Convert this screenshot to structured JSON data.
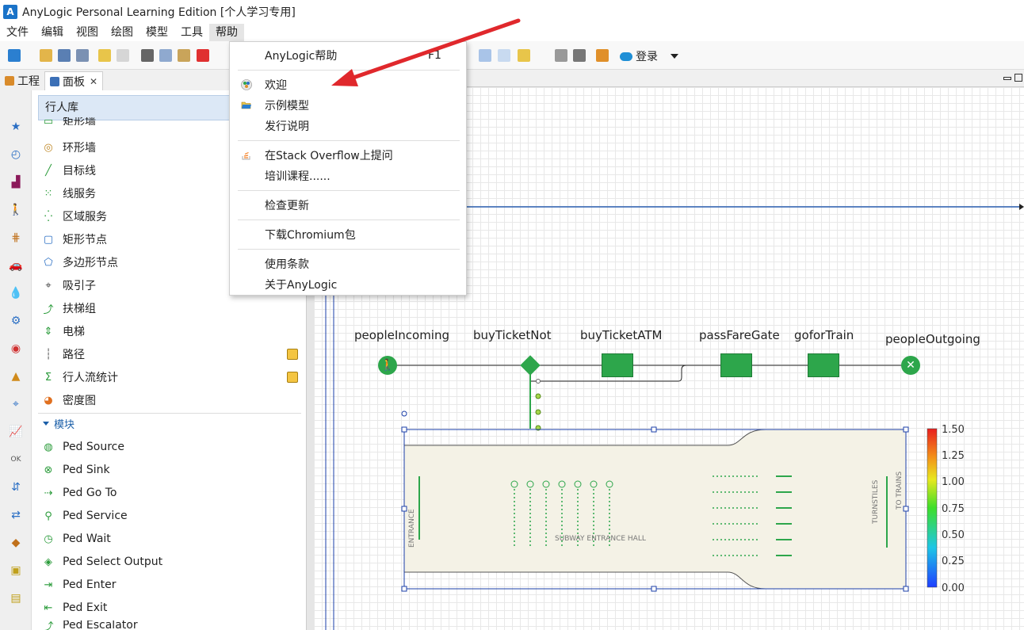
{
  "window": {
    "title": "AnyLogic Personal Learning Edition [个人学习专用]"
  },
  "menubar": {
    "items": [
      "文件",
      "编辑",
      "视图",
      "绘图",
      "模型",
      "工具",
      "帮助"
    ]
  },
  "toolbar": {
    "login_label": "登录"
  },
  "left_panel": {
    "tabs": [
      {
        "label": "工程"
      },
      {
        "label": "面板"
      }
    ],
    "close_symbol": "✕",
    "library_title": "行人库",
    "space_items": [
      {
        "label": "矩形墙"
      },
      {
        "label": "环形墙"
      },
      {
        "label": "目标线"
      },
      {
        "label": "线服务"
      },
      {
        "label": "区域服务"
      },
      {
        "label": "矩形节点"
      },
      {
        "label": "多边形节点"
      },
      {
        "label": "吸引子"
      },
      {
        "label": "扶梯组"
      },
      {
        "label": "电梯"
      },
      {
        "label": "路径"
      },
      {
        "label": "行人流统计"
      },
      {
        "label": "密度图"
      }
    ],
    "section_label": "模块",
    "block_items": [
      {
        "label": "Ped Source"
      },
      {
        "label": "Ped Sink"
      },
      {
        "label": "Ped Go To"
      },
      {
        "label": "Ped Service"
      },
      {
        "label": "Ped Wait"
      },
      {
        "label": "Ped Select Output"
      },
      {
        "label": "Ped Enter"
      },
      {
        "label": "Ped Exit"
      },
      {
        "label": "Ped Escalator"
      }
    ]
  },
  "help_menu": {
    "items": [
      {
        "label": "AnyLogic帮助",
        "shortcut": "F1"
      },
      {
        "label": "欢迎"
      },
      {
        "label": "示例模型"
      },
      {
        "label": "发行说明"
      },
      {
        "label": "在Stack Overflow上提问"
      },
      {
        "label": "培训课程......"
      },
      {
        "label": "检查更新"
      },
      {
        "label": "下载Chromium包"
      },
      {
        "label": "使用条款"
      },
      {
        "label": "关于AnyLogic"
      }
    ]
  },
  "diagram": {
    "blocks": [
      {
        "label": "peopleIncoming"
      },
      {
        "label": "buyTicketNot"
      },
      {
        "label": "buyTicketATM"
      },
      {
        "label": "passFareGate"
      },
      {
        "label": "goforTrain"
      },
      {
        "label": "peopleOutgoing"
      }
    ],
    "hall": {
      "entrance": "ENTRANCE",
      "name": "SUBWAY ENTRANCE HALL",
      "turnstiles": "TURNSTILES",
      "to_trains": "TO TRAINS"
    },
    "legend": {
      "ticks": [
        "1.50",
        "1.25",
        "1.00",
        "0.75",
        "0.50",
        "0.25",
        "0.00"
      ]
    }
  },
  "colors": {
    "accent": "#2da64b",
    "arrow": "#e0282c",
    "selection": "#1b3fa8",
    "menu_highlight": "#dce8f6"
  }
}
